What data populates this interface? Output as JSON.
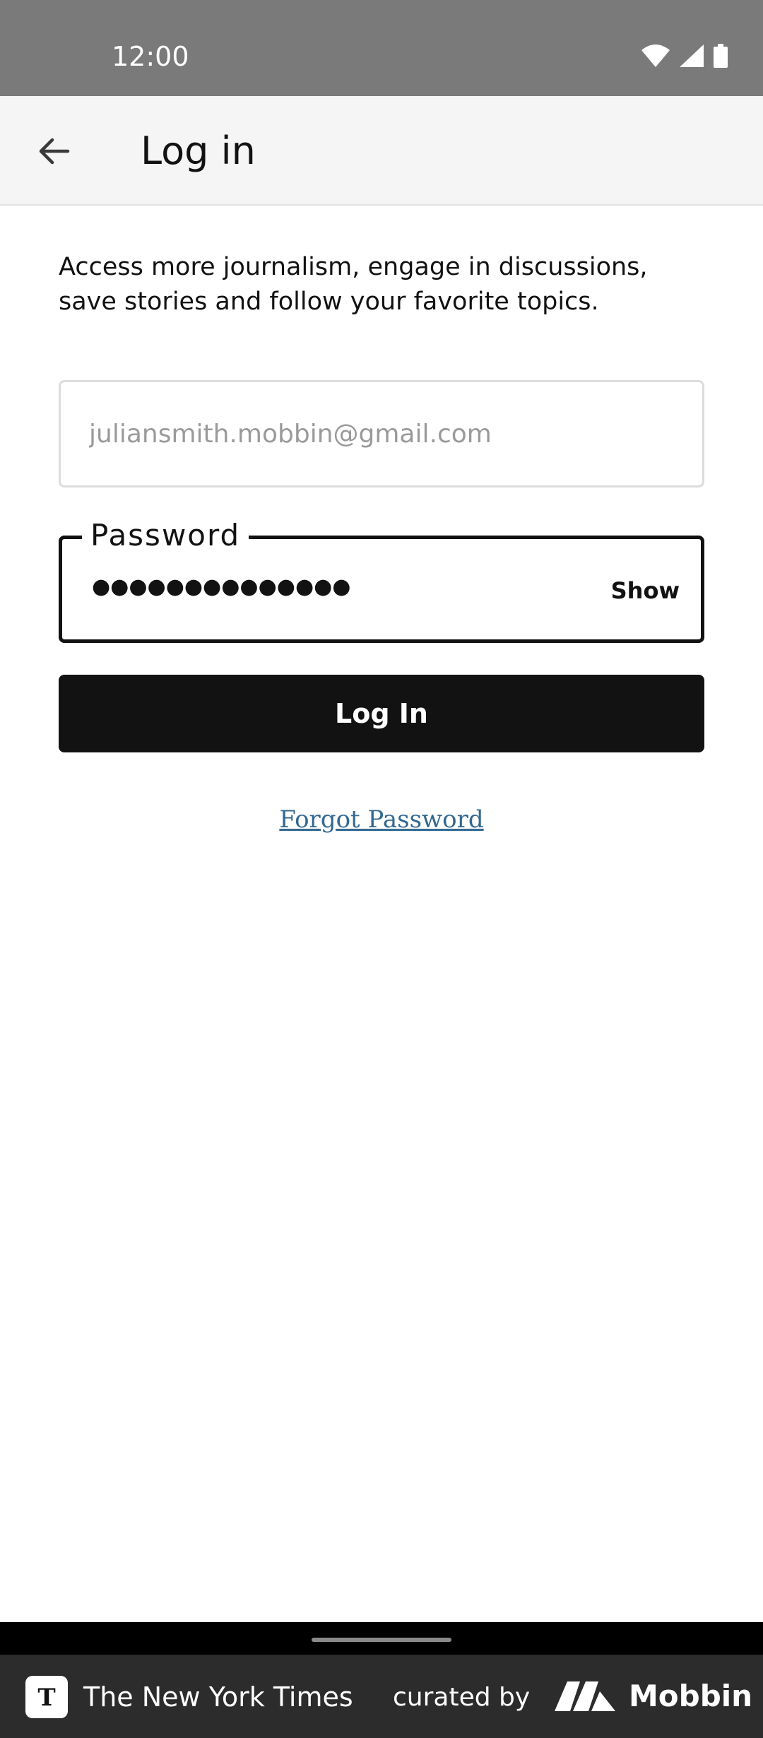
{
  "status_bar": {
    "time": "12:00",
    "icons": [
      "wifi-icon",
      "signal-icon",
      "battery-icon"
    ]
  },
  "app_bar": {
    "back_icon": "arrow-left-icon",
    "title": "Log in"
  },
  "intro": {
    "text": "Access more journalism, engage in discussions, save stories and follow your favorite topics."
  },
  "email_field": {
    "value": "",
    "placeholder": "juliansmith.mobbin@gmail.com"
  },
  "password_field": {
    "label": "Password",
    "masked_value": "●●●●●●●●●●●●●●",
    "show_label": "Show"
  },
  "login_button": {
    "label": "Log In"
  },
  "forgot_password": {
    "label": "Forgot Password"
  },
  "footer": {
    "brand": "The New York Times",
    "curated_by": "curated by",
    "mobbin": "Mobbin"
  },
  "colors": {
    "status_bar": "#7a7a7a",
    "app_bar": "#f5f5f5",
    "primary": "#121212",
    "link": "#326891",
    "footer": "#2c2c2c"
  }
}
